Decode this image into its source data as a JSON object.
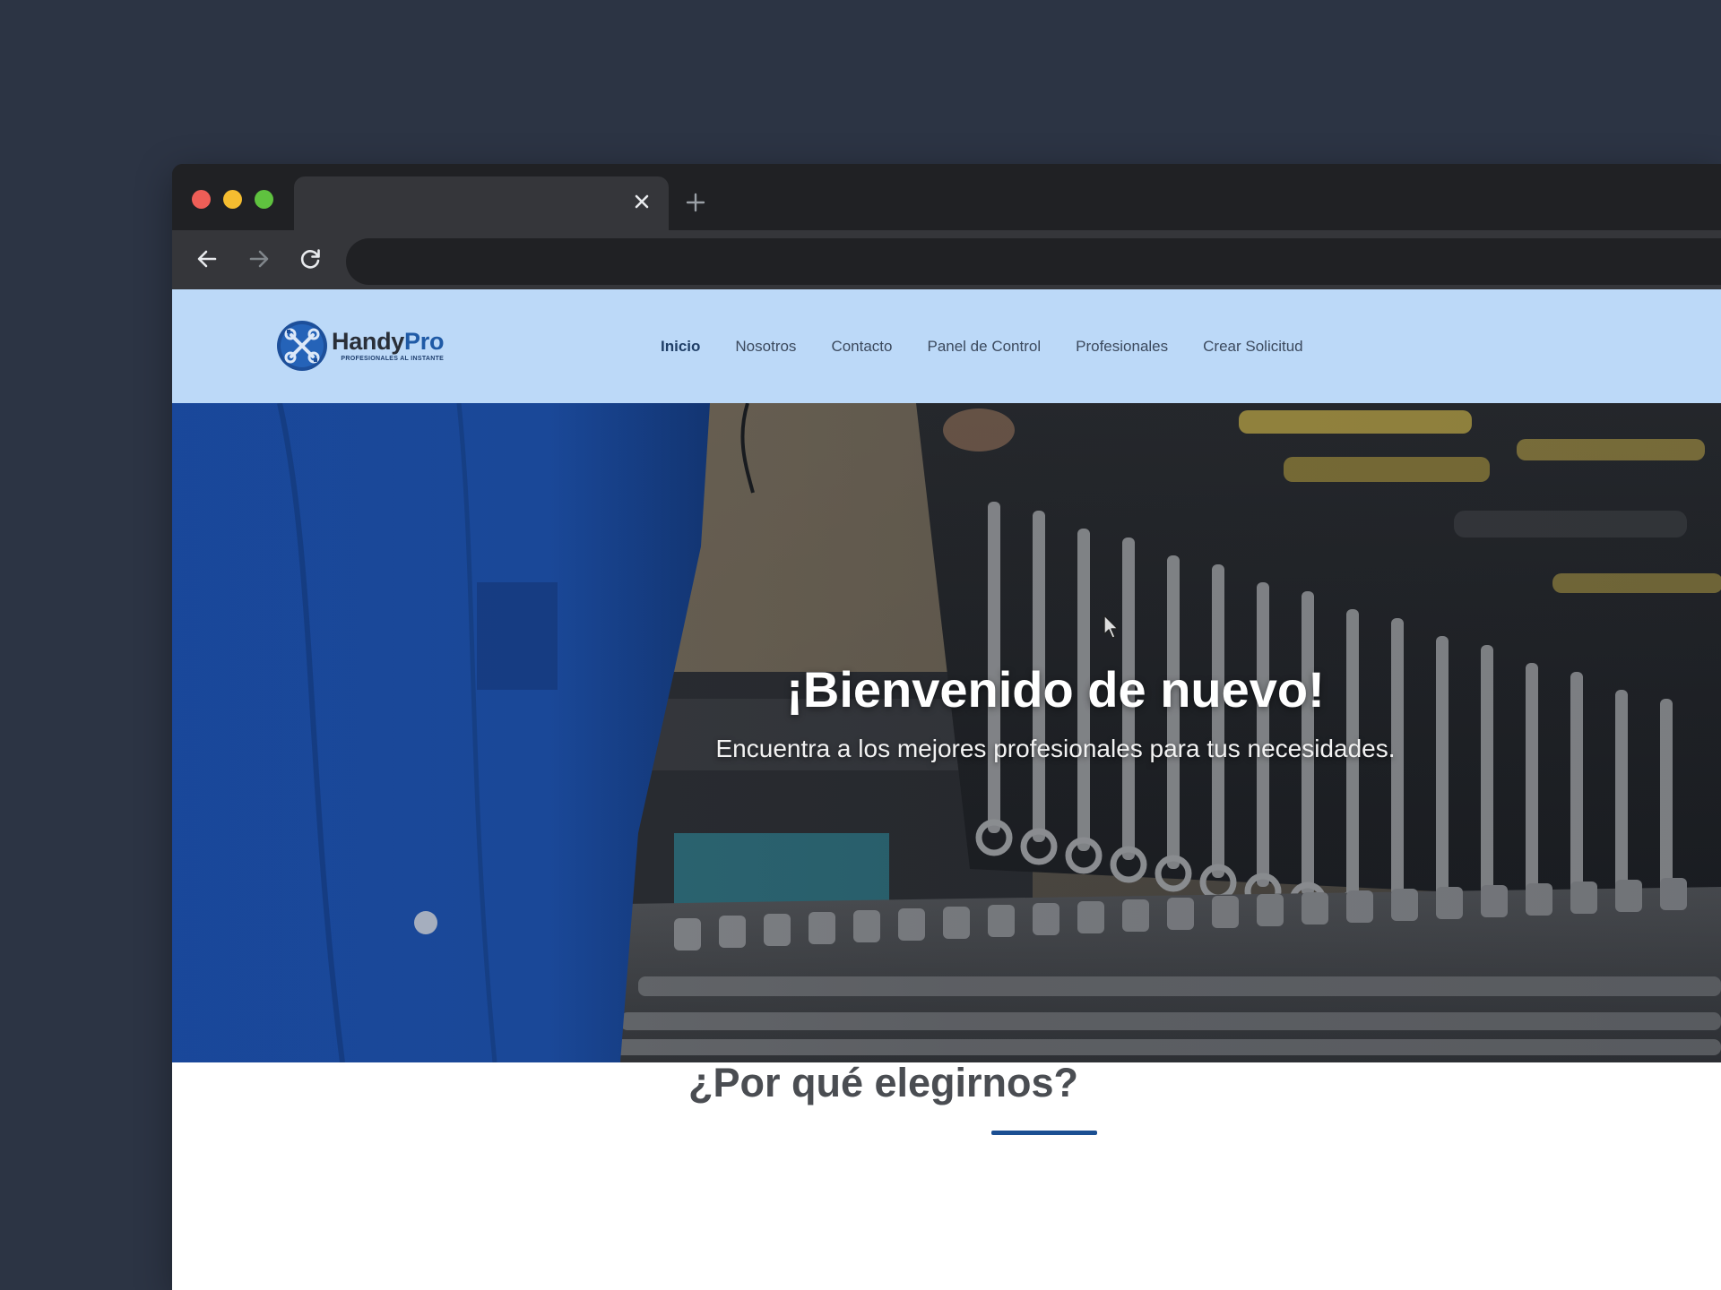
{
  "window": {
    "controls": [
      "close",
      "minimize",
      "maximize"
    ],
    "tab": {
      "title": "",
      "close_icon": "close-icon"
    },
    "new_tab_icon": "plus-icon"
  },
  "toolbar": {
    "back_icon": "back-arrow-icon",
    "forward_icon": "forward-arrow-icon",
    "reload_icon": "reload-icon",
    "address": ""
  },
  "site": {
    "logo": {
      "name_part1": "Handy",
      "name_part2": "Pro",
      "tagline": "PROFESIONALES AL INSTANTE"
    },
    "nav": [
      {
        "label": "Inicio",
        "active": true
      },
      {
        "label": "Nosotros",
        "active": false
      },
      {
        "label": "Contacto",
        "active": false
      },
      {
        "label": "Panel de Control",
        "active": false
      },
      {
        "label": "Profesionales",
        "active": false
      },
      {
        "label": "Crear Solicitud",
        "active": false
      }
    ],
    "hero": {
      "title": "¡Bienvenido de nuevo!",
      "subtitle": "Encuentra a los mejores profesionales para tus necesidades.",
      "background": "mechanic-toolbox-photo"
    },
    "why": {
      "title": "¿Por qué elegirnos?"
    }
  },
  "colors": {
    "desktop": "#2c3444",
    "nav_bg": "#bcd9f8",
    "accent": "#1b4f92",
    "overall_blue": "#1c4da0"
  }
}
